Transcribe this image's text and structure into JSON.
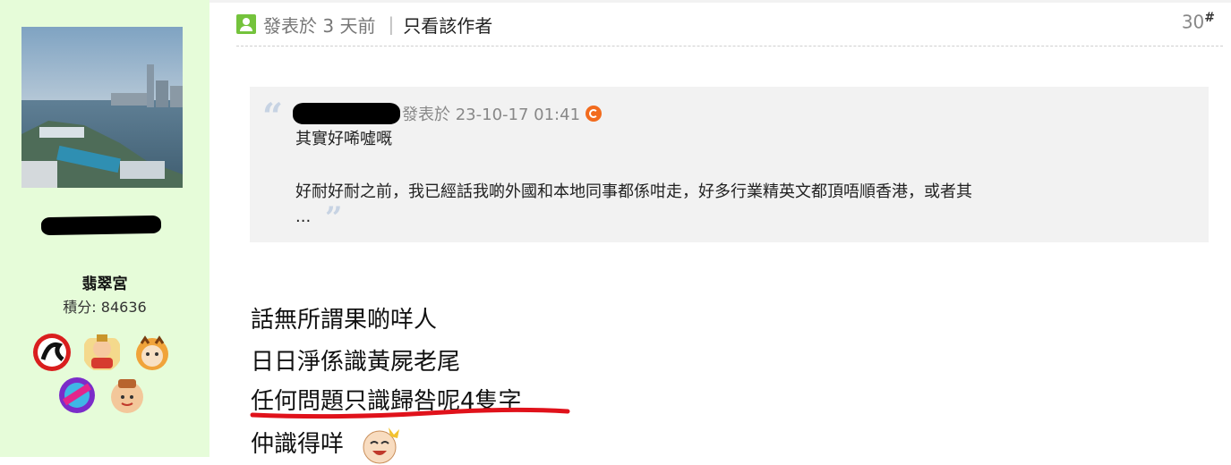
{
  "author": {
    "group": "翡翠宮",
    "points_label": "積分: 84636",
    "badges": [
      "calligraphy-badge",
      "fortune-badge",
      "tiger-badge",
      "ribbon-badge",
      "cake-badge"
    ]
  },
  "post_header": {
    "posted_label": "發表於 3 天前",
    "separator": "|",
    "only_author_link": "只看該作者",
    "floor_number": "30",
    "floor_symbol": "#"
  },
  "quote": {
    "posted_label": "發表於 23-10-17 01:41",
    "line1": "其實好唏噓嘅",
    "line2": "好耐好耐之前，我已經話我啲外國和本地同事都係咁走，好多行業精英文都頂唔順香港，或者其",
    "line3": "...",
    "open_mark": "“",
    "close_mark": "”"
  },
  "post_body": {
    "line1": "話無所謂果啲咩人",
    "line2": "日日淨係識黃屍老尾",
    "line3": "任何問題只識歸咎呢4隻字",
    "line4": "仲識得咩"
  },
  "colors": {
    "sidebar_bg": "#e6fcd9",
    "quote_bg": "#f2f2f2",
    "username_accent": "#e87c1e",
    "post_icon": "#74c33c",
    "underline_mark": "#e0121b"
  },
  "icons": [
    "user-post-icon",
    "refresh-icon",
    "laughing-emoji-icon"
  ]
}
